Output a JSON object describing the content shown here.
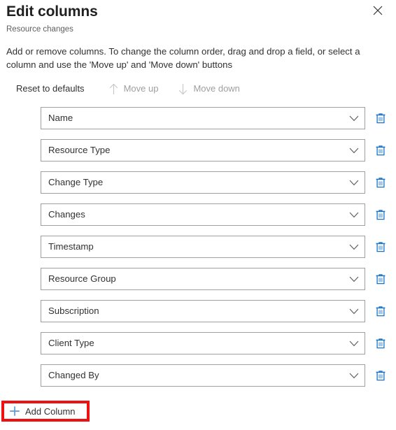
{
  "panel": {
    "title": "Edit columns",
    "subtitle": "Resource changes",
    "description": "Add or remove columns. To change the column order, drag and drop a field, or select a column and use the 'Move up' and 'Move down' buttons",
    "close_icon": "close-icon"
  },
  "commandbar": {
    "reset": {
      "label": "Reset to defaults",
      "disabled": false
    },
    "move_up": {
      "label": "Move up",
      "icon": "arrow-up-icon",
      "disabled": true
    },
    "move_down": {
      "label": "Move down",
      "icon": "arrow-down-icon",
      "disabled": true
    }
  },
  "columns": [
    {
      "label": "Name",
      "chevron_icon": "chevron-down-icon",
      "delete_icon": "trash-icon"
    },
    {
      "label": "Resource Type",
      "chevron_icon": "chevron-down-icon",
      "delete_icon": "trash-icon"
    },
    {
      "label": "Change Type",
      "chevron_icon": "chevron-down-icon",
      "delete_icon": "trash-icon"
    },
    {
      "label": "Changes",
      "chevron_icon": "chevron-down-icon",
      "delete_icon": "trash-icon"
    },
    {
      "label": "Timestamp",
      "chevron_icon": "chevron-down-icon",
      "delete_icon": "trash-icon"
    },
    {
      "label": "Resource Group",
      "chevron_icon": "chevron-down-icon",
      "delete_icon": "trash-icon"
    },
    {
      "label": "Subscription",
      "chevron_icon": "chevron-down-icon",
      "delete_icon": "trash-icon"
    },
    {
      "label": "Client Type",
      "chevron_icon": "chevron-down-icon",
      "delete_icon": "trash-icon"
    },
    {
      "label": "Changed By",
      "chevron_icon": "chevron-down-icon",
      "delete_icon": "trash-icon"
    }
  ],
  "add_column": {
    "label": "Add Column",
    "icon": "plus-icon",
    "highlight_color": "#ee1111"
  },
  "colors": {
    "accent_blue": "#0078d4",
    "text_primary": "#323130",
    "text_secondary": "#605e5c",
    "text_disabled": "#a19f9d",
    "border": "#a19f9d",
    "highlight_red": "#ee1111",
    "background": "#ffffff"
  }
}
